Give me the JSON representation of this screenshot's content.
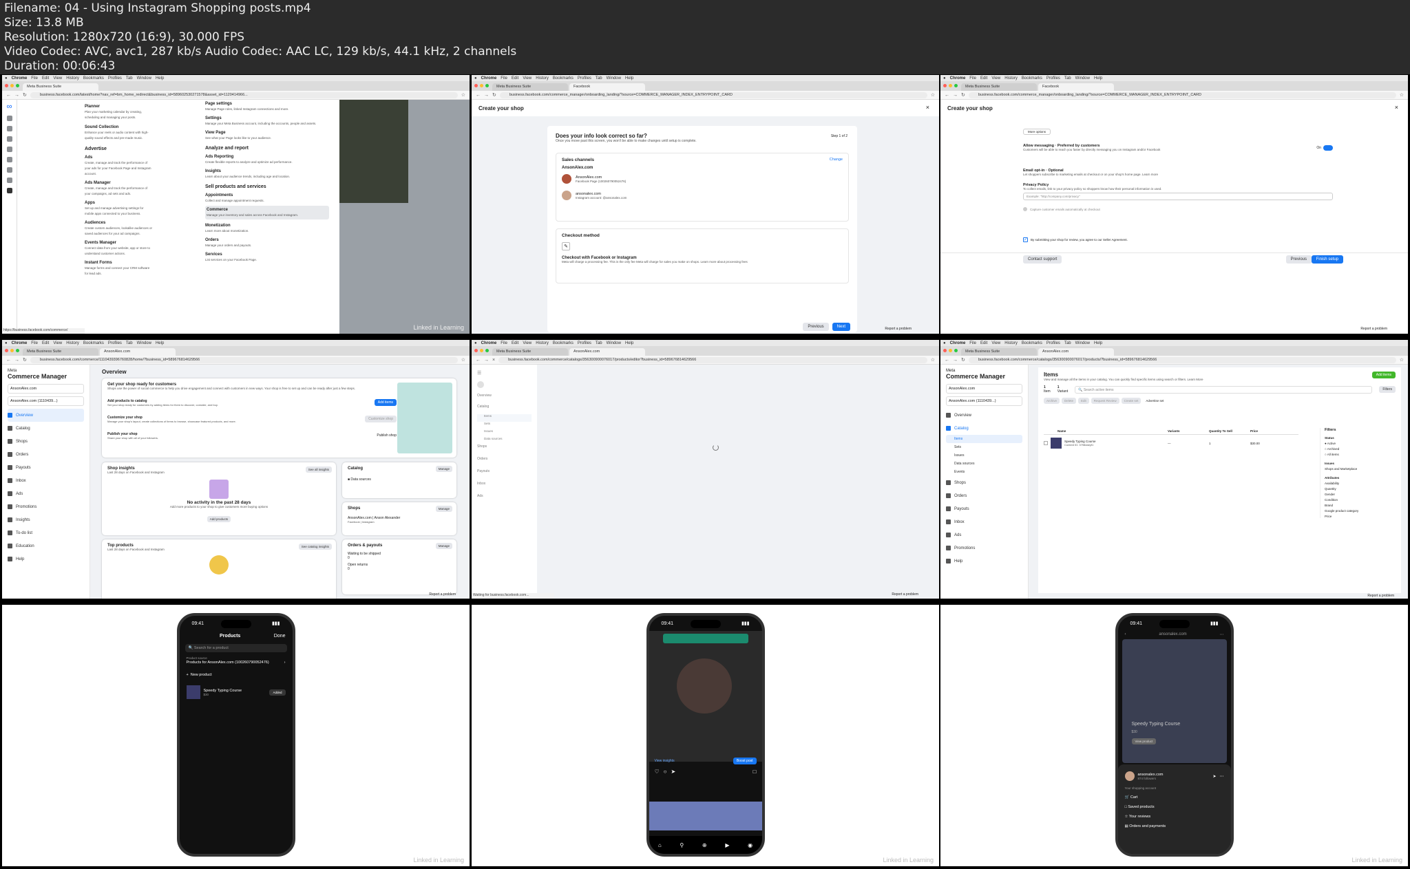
{
  "header": {
    "filename": "Filename: 04 - Using Instagram Shopping posts.mp4",
    "size": "Size: 13.8 MB",
    "resolution": "Resolution: 1280x720 (16:9), 30.000 FPS",
    "codec": "Video Codec: AVC, avc1, 287 kb/s Audio Codec: AAC LC, 129 kb/s, 44.1 kHz, 2 channels",
    "duration": "Duration: 00:06:43"
  },
  "browser": {
    "app": "Chrome",
    "menu": [
      "File",
      "Edit",
      "View",
      "History",
      "Bookmarks",
      "Profiles",
      "Tab",
      "Window",
      "Help"
    ],
    "tab_meta": "Meta Business Suite",
    "tab_fb": "Facebook",
    "tab_anson": "AnsonAlex.com"
  },
  "thumb1": {
    "url": "business.facebook.com/latest/home?nav_ref=bm_home_redirect&business_id=589602530271578&asset_id=1120414966...",
    "col1": [
      {
        "title": "Planner",
        "desc": "Plan your marketing calendar by creating, scheduling and managing your posts."
      },
      {
        "title": "Sound Collection",
        "desc": "Enhance your reels or audio content with high-quality sound effects and pre-made music."
      },
      {
        "title": "Advertise",
        "desc": ""
      },
      {
        "title": "Ads",
        "desc": "Create, manage and track the performance of your ads for your Facebook Page and Instagram account."
      },
      {
        "title": "Ads Manager",
        "desc": "Create, manage and track the performance of your campaigns, ad sets and ads."
      },
      {
        "title": "Apps",
        "desc": "Set up and manage advertising settings for mobile apps connected to your business."
      },
      {
        "title": "Audiences",
        "desc": "Create custom audiences, lookalike audiences or saved audiences for your ad campaigns."
      },
      {
        "title": "Events Manager",
        "desc": "Connect data from your website, app or store to understand customer actions."
      },
      {
        "title": "Instant Forms",
        "desc": "Manage forms and connect your CRM software for lead ads."
      }
    ],
    "col2": [
      {
        "title": "Page settings",
        "desc": "Manage Page roles, linked Instagram connections and more."
      },
      {
        "title": "Settings",
        "desc": "Manage your Meta Business account, including the accounts, people and assets."
      },
      {
        "title": "View Page",
        "desc": "See what your Page looks like to your audience."
      },
      {
        "title": "Analyze and report",
        "desc": ""
      },
      {
        "title": "Ads Reporting",
        "desc": "Create flexible reports to analyze and optimize ad performance."
      },
      {
        "title": "Insights",
        "desc": "Learn about your audience trends, including age and location."
      },
      {
        "title": "Sell products and services",
        "desc": ""
      },
      {
        "title": "Appointments",
        "desc": "Collect and manage appointment requests."
      },
      {
        "title": "Commerce",
        "desc": "Manage your inventory and sales across Facebook and Instagram."
      },
      {
        "title": "Monetization",
        "desc": "Learn more about monetization."
      },
      {
        "title": "Orders",
        "desc": "Manage your orders and payouts."
      },
      {
        "title": "Services",
        "desc": "List services on your Facebook Page."
      }
    ],
    "status_url": "https://business.facebook.com/commerce/",
    "watermark": "Linked in Learning"
  },
  "thumb2": {
    "url": "business.facebook.com/commerce_manager/onboarding_landing/?source=COMMERCE_MANAGER_INDEX_ENTRYPOINT_CARD",
    "modal_title": "Create your shop",
    "heading": "Does your info look correct so far?",
    "subheading": "Once you move past this screen, you won't be able to make changes until setup is complete.",
    "step": "Step 1 of 2",
    "sales_channels": "Sales channels",
    "change": "Change",
    "shop_name": "AnsonAlex.com",
    "fb_page": "AnsonAlex.com",
    "fb_page_sub": "Facebook Page (100260790052476)",
    "ig_account": "ansonalex.com",
    "ig_account_sub": "Instagram account: @ansonalex.com",
    "checkout_method": "Checkout method",
    "checkout_title": "Checkout with Facebook or Instagram",
    "checkout_desc": "Meta will charge a processing fee. This is the only fee Meta will charge for sales you make on shops. Learn more about processing fees",
    "previous": "Previous",
    "next": "Next",
    "report": "Report a problem"
  },
  "thumb3": {
    "url": "business.facebook.com/commerce_manager/onboarding_landing/?source=COMMERCE_MANAGER_INDEX_ENTRYPOINT_CARD",
    "modal_title": "Create your shop",
    "more_options": "More options",
    "allow_messaging": "Allow messaging · Preferred by customers",
    "allow_messaging_desc": "Customers will be able to reach you faster by directly messaging you on Instagram and/or Facebook",
    "on": "On",
    "email_optin": "Email opt-in · Optional",
    "email_optin_desc": "Let shoppers subscribe to marketing emails at checkout or on your shop's home page. Learn more",
    "privacy_policy": "Privacy Policy",
    "privacy_desc": "To collect emails, link to your privacy policy so shoppers know how their personal information is used.",
    "privacy_placeholder": "Example: \"http://company.com/privacy\"",
    "capture_emails": "Capture customer emails automatically at checkout",
    "agree": "By submitting your shop for review, you agree to our Seller Agreement.",
    "contact_support": "Contact support",
    "previous": "Previous",
    "finish": "Finish setup",
    "report": "Report a problem"
  },
  "thumb4": {
    "url": "business.facebook.com/commerce/1110439396760828/home/?business_id=589676814629566",
    "brand": "Meta",
    "app_title": "Commerce Manager",
    "account": "AnsonAlex.com",
    "shop_select": "AnsonAlex.com (1110439...)",
    "nav": [
      "Overview",
      "Catalog",
      "Shops",
      "Orders",
      "Payouts",
      "Inbox",
      "Ads",
      "Promotions",
      "Insights",
      "To-do list",
      "Education",
      "Help"
    ],
    "overview": "Overview",
    "ready_title": "Get your shop ready for customers",
    "ready_desc": "Shops use the power of social commerce to help you drive engagement and connect with customers in new ways. Your shop is free to set up and can be ready after just a few steps.",
    "tasks": [
      {
        "title": "Add products to catalog",
        "desc": "Set your shop ready for customers by adding items for them to discover, consider, and buy.",
        "action": "Add items"
      },
      {
        "title": "Customize your shop",
        "desc": "Manage your shop's layout, create collections of items to browse, showcase featured products, and more.",
        "action": "Customize shop"
      },
      {
        "title": "Publish your shop",
        "desc": "Share your shop with all of your followers.",
        "action": "Publish shop"
      }
    ],
    "shop_insights": "Shop insights",
    "shop_insights_sub": "Last 28 days on Facebook and Instagram",
    "see_all_insights": "See all insights",
    "no_activity": "No activity in the past 28 days",
    "no_activity_desc": "Add more products to your shop to give customers more buying options",
    "add_products": "Add products",
    "catalog": "Catalog",
    "manage": "Manage",
    "data_sources": "Data sources",
    "shops": "Shops",
    "shop_entry": "AnsonAlex.com | Anson Alexander",
    "shop_entry_sub": "Facebook | Instagram",
    "orders_payouts": "Orders & payouts",
    "waiting": "Waiting to be shipped",
    "waiting_count": "0",
    "open_returns": "Open returns",
    "returns_count": "0",
    "top_products": "Top products",
    "top_products_sub": "Last 28 days on Facebook and Instagram",
    "see_catalog_insights": "See catalog insights",
    "report": "Report a problem"
  },
  "thumb5": {
    "url": "business.facebook.com/commerce/catalogs/356300900076017/products/editor?business_id=589676814629566",
    "nav": [
      "Overview",
      "Catalog",
      "Items",
      "Sets",
      "Issues",
      "Data sources",
      "Shops",
      "Orders",
      "Payouts",
      "Inbox",
      "Ads"
    ],
    "status": "Waiting for business.facebook.com...",
    "report": "Report a problem"
  },
  "thumb6": {
    "url": "business.facebook.com/commerce/catalogs/356300900076017/products/?business_id=589676814629566",
    "brand": "Meta",
    "app_title": "Commerce Manager",
    "account": "AnsonAlex.com",
    "shop_select": "AnsonAlex.com (1110439...)",
    "nav": [
      "Overview",
      "Catalog",
      "Items",
      "Sets",
      "Issues",
      "Data sources",
      "Events",
      "Shops",
      "Orders",
      "Payouts",
      "Inbox",
      "Ads",
      "Promotions",
      "Help"
    ],
    "items_title": "Items",
    "items_desc": "View and manage all the items in your catalog. You can quickly find specific items using search or filters. Learn More",
    "add_items": "Add items",
    "item_count": "1",
    "item_label": "Item",
    "variant_count": "1",
    "variant_label": "Variant",
    "search_placeholder": "Search active items",
    "filters": "Filters",
    "toolbar": [
      "Archive",
      "Delete",
      "Edit",
      "Request Review",
      "Create set",
      "Advertise set"
    ],
    "columns": [
      "Name",
      "Variants",
      "Quantity To Sell",
      "Price"
    ],
    "row": {
      "name": "Speedy Typing Course",
      "content_id": "Content ID: 3798daeyf1",
      "variants": "—",
      "qty": "1",
      "price": "$30.00"
    },
    "filters_panel": {
      "title": "Filters",
      "status": "Status",
      "status_opts": [
        "Active",
        "Archived",
        "All items"
      ],
      "issues": "Issues",
      "issues_opt": "Shops and Marketplace",
      "attributes": "Attributes",
      "attr_opts": [
        "Availability",
        "Quantity",
        "Gender",
        "Condition",
        "Brand",
        "Google product category",
        "Price"
      ]
    },
    "report": "Report a problem"
  },
  "thumb7": {
    "time": "09:41",
    "title": "Products",
    "done": "Done",
    "search": "Search for a product",
    "source_label": "Product source",
    "source": "Products for AnsonAlex.com (100260790052476)",
    "new_product": "New product",
    "product_name": "Speedy Typing Course",
    "product_price": "$30",
    "added": "Added",
    "watermark": "Linked in Learning"
  },
  "thumb8": {
    "time": "09:41",
    "view_insights": "View insights",
    "boost": "Boost post",
    "watermark": "Linked in Learning"
  },
  "thumb9": {
    "time": "09:41",
    "header_user": "ansonalex.com",
    "product_name": "Speedy Typing Course",
    "product_price": "$30",
    "view_product": "View product",
    "user": "ansonalex.com",
    "followers": "874 followers",
    "your_account": "Your shopping account",
    "menu": [
      "Cart",
      "Saved products",
      "Your reviews",
      "Orders and payments"
    ],
    "watermark": "Linked in Learning"
  }
}
